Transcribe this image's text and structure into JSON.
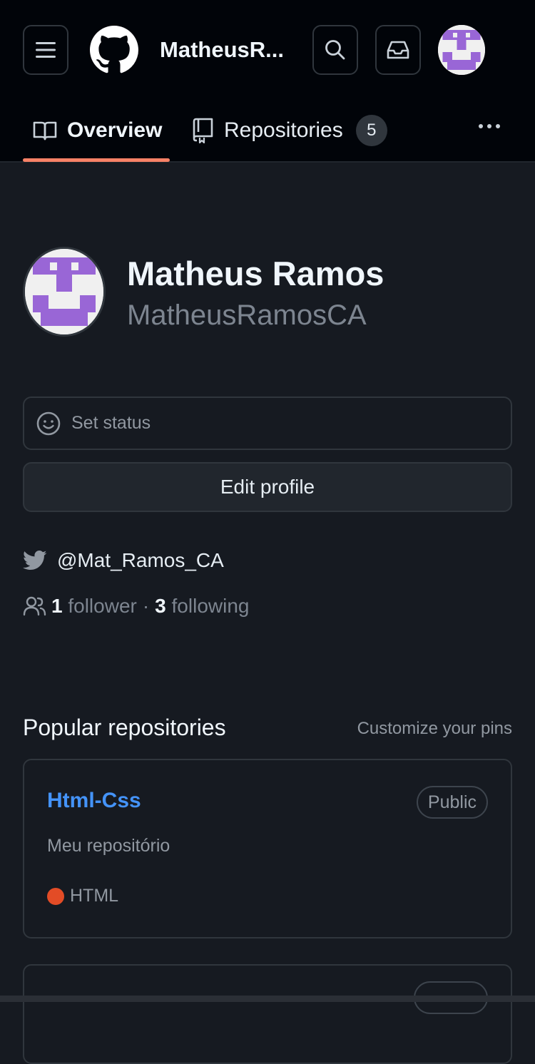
{
  "header": {
    "username_short": "MatheusR...",
    "menu_icon": "hamburger-menu-icon",
    "logo_icon": "github-logo-icon",
    "search_icon": "search-icon",
    "inbox_icon": "inbox-icon"
  },
  "tabs": [
    {
      "label": "Overview",
      "icon": "book-icon",
      "selected": true
    },
    {
      "label": "Repositories",
      "icon": "repo-icon",
      "count": "5"
    }
  ],
  "profile": {
    "name": "Matheus Ramos",
    "login": "MatheusRamosCA",
    "set_status": "Set status",
    "edit_profile": "Edit profile",
    "twitter": "@Mat_Ramos_CA",
    "followers_count": "1",
    "followers_label": "follower",
    "separator": "·",
    "following_count": "3",
    "following_label": "following"
  },
  "popular": {
    "title": "Popular repositories",
    "customize": "Customize your pins",
    "repos": [
      {
        "name": "Html-Css",
        "visibility": "Public",
        "description": "Meu repositório",
        "language": "HTML",
        "language_color": "#e34c26"
      }
    ]
  },
  "colors": {
    "accent_underline": "#f78166",
    "link": "#4493f8",
    "avatar_purple": "#9966d6"
  }
}
